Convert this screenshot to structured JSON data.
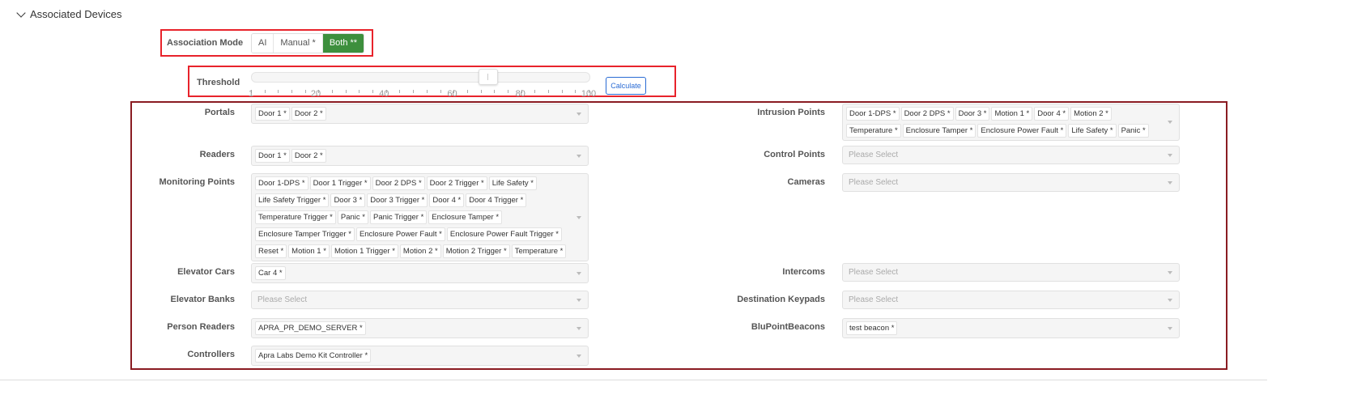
{
  "section": {
    "title": "Associated Devices"
  },
  "association_mode": {
    "label": "Association Mode",
    "options": [
      "AI",
      "Manual *",
      "Both **"
    ],
    "selected": "Both **",
    "accent": "#3d8f3d"
  },
  "threshold": {
    "label": "Threshold",
    "value": 70,
    "min": 1,
    "max": 100,
    "tick_labels": [
      "1",
      "20",
      "40",
      "60",
      "80",
      "100"
    ],
    "calculate_label": "Calculate"
  },
  "left_fields": [
    {
      "label": "Portals",
      "tags": [
        "Door 1 *",
        "Door 2 *"
      ]
    },
    {
      "label": "Readers",
      "tags": [
        "Door 1 *",
        "Door 2 *"
      ]
    },
    {
      "label": "Monitoring Points",
      "tags": [
        "Door 1-DPS *",
        "Door 1 Trigger *",
        "Door 2 DPS *",
        "Door 2 Trigger *",
        "Life Safety *",
        "Life Safety Trigger *",
        "Door 3 *",
        "Door 3 Trigger *",
        "Door 4 *",
        "Door 4 Trigger *",
        "Temperature Trigger *",
        "Panic *",
        "Panic Trigger *",
        "Enclosure Tamper *",
        "Enclosure Tamper Trigger *",
        "Enclosure Power Fault *",
        "Enclosure Power Fault Trigger *",
        "Reset *",
        "Motion 1 *",
        "Motion 1 Trigger *",
        "Motion 2 *",
        "Motion 2 Trigger *",
        "Temperature *"
      ]
    },
    {
      "label": "Elevator Cars",
      "tags": [
        "Car 4 *"
      ]
    },
    {
      "label": "Elevator Banks",
      "tags": [],
      "placeholder": "Please Select"
    },
    {
      "label": "Person Readers",
      "tags": [
        "APRA_PR_DEMO_SERVER *"
      ]
    },
    {
      "label": "Controllers",
      "tags": [
        "Apra Labs Demo Kit Controller *"
      ]
    }
  ],
  "right_fields": [
    {
      "label": "Intrusion Points",
      "tags": [
        "Door 1-DPS *",
        "Door 2 DPS *",
        "Door 3 *",
        "Motion 1 *",
        "Door 4 *",
        "Motion 2 *",
        "Temperature *",
        "Enclosure Tamper *",
        "Enclosure Power Fault *",
        "Life Safety *",
        "Panic *"
      ]
    },
    {
      "label": "Control Points",
      "tags": [],
      "placeholder": "Please Select"
    },
    {
      "label": "Cameras",
      "tags": [],
      "placeholder": "Please Select"
    },
    {
      "label": "Intercoms",
      "tags": [],
      "placeholder": "Please Select"
    },
    {
      "label": "Destination Keypads",
      "tags": [],
      "placeholder": "Please Select"
    },
    {
      "label": "BluPointBeacons",
      "tags": [
        "test beacon *"
      ]
    }
  ]
}
